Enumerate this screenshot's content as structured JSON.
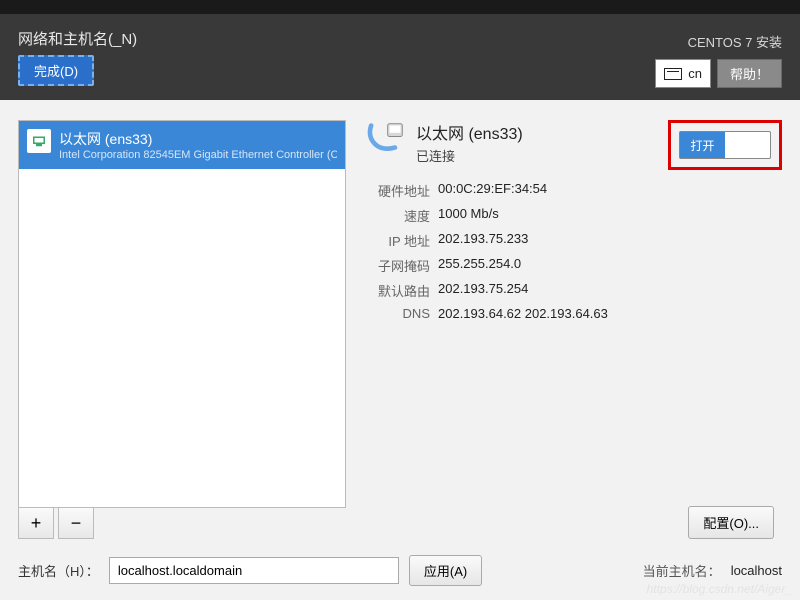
{
  "header": {
    "title": "网络和主机名(_N)",
    "done": "完成(D)",
    "installer": "CENTOS 7 安装",
    "kbd": "cn",
    "help": "帮助！"
  },
  "nic_list": {
    "items": [
      {
        "title": "以太网 (ens33)",
        "sub": "Intel Corporation 82545EM Gigabit Ethernet Controller (C"
      }
    ],
    "add": "+",
    "remove": "−"
  },
  "nic": {
    "title": "以太网 (ens33)",
    "status": "已连接",
    "toggle_on": "打开"
  },
  "details": {
    "hwaddr_label": "硬件地址",
    "hwaddr": "00:0C:29:EF:34:54",
    "speed_label": "速度",
    "speed": "1000 Mb/s",
    "ip_label": "IP 地址",
    "ip": "202.193.75.233",
    "mask_label": "子网掩码",
    "mask": "255.255.254.0",
    "gw_label": "默认路由",
    "gw": "202.193.75.254",
    "dns_label": "DNS",
    "dns": "202.193.64.62 202.193.64.63"
  },
  "buttons": {
    "configure": "配置(O)...",
    "apply": "应用(A)"
  },
  "hostname": {
    "label": "主机名（H）：",
    "value": "localhost.localdomain",
    "current_label": "当前主机名：",
    "current": "localhost"
  },
  "watermark": "https://blog.csdn.net/Aiger_"
}
